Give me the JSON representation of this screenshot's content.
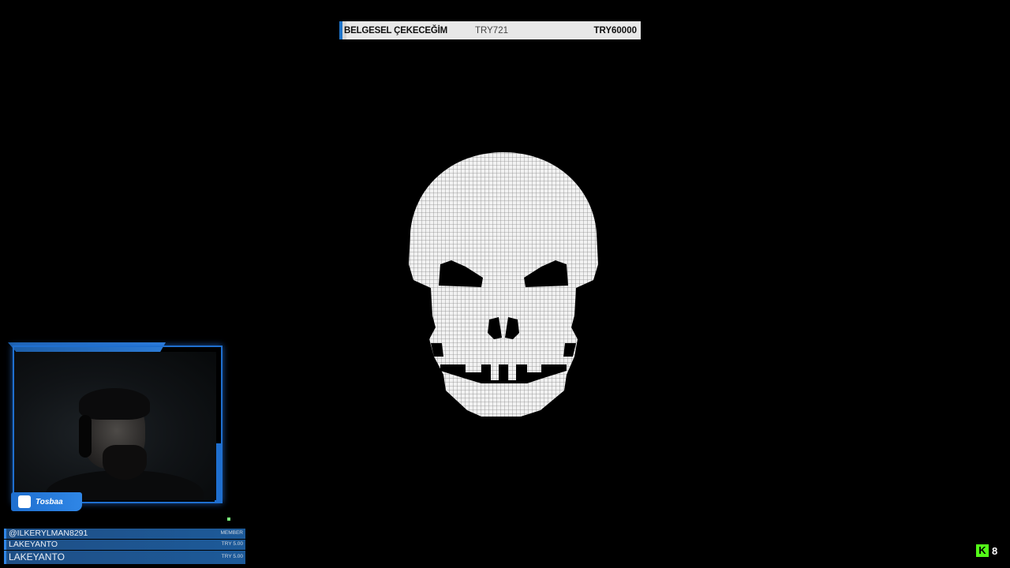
{
  "goal": {
    "title": "BELGESEL ÇEKECEĞİM",
    "current": "TRY721",
    "target": "TRY60000",
    "progress_fraction": 0.012
  },
  "streamer": {
    "name": "Tosbaa"
  },
  "events": [
    {
      "user": "@ILKERYLMAN8291",
      "meta": "MEMBER"
    },
    {
      "user": "LAKEYANTO",
      "meta": "TRY 5.00"
    },
    {
      "user": "LAKEYANTO",
      "meta": "TRY 5.00"
    }
  ],
  "viewers": {
    "logo": "K",
    "count": "8"
  },
  "colors": {
    "accent": "#1f6fcf",
    "kick_green": "#53fc18",
    "background": "#000000"
  },
  "icons": [
    "skull-icon",
    "patreon-icon",
    "kick-logo-icon"
  ]
}
